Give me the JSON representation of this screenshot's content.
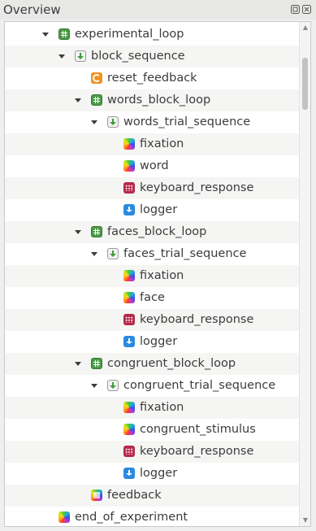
{
  "panel": {
    "title": "Overview",
    "float_label": "⧉",
    "close_label": "✕"
  },
  "scroll": {
    "up": "▲",
    "down": "▼"
  },
  "tree": [
    {
      "label": "experimental_loop",
      "type": "loop",
      "level": 0,
      "expanded": true
    },
    {
      "label": "block_sequence",
      "type": "sequence",
      "level": 1,
      "expanded": true
    },
    {
      "label": "reset_feedback",
      "type": "reset",
      "level": 2
    },
    {
      "label": "words_block_loop",
      "type": "loop",
      "level": 2,
      "expanded": true
    },
    {
      "label": "words_trial_sequence",
      "type": "sequence",
      "level": 3,
      "expanded": true
    },
    {
      "label": "fixation",
      "type": "sketchpad",
      "level": 4
    },
    {
      "label": "word",
      "type": "sketchpad",
      "level": 4
    },
    {
      "label": "keyboard_response",
      "type": "keyboard",
      "level": 4
    },
    {
      "label": "logger",
      "type": "logger",
      "level": 4
    },
    {
      "label": "faces_block_loop",
      "type": "loop",
      "level": 2,
      "expanded": true
    },
    {
      "label": "faces_trial_sequence",
      "type": "sequence",
      "level": 3,
      "expanded": true
    },
    {
      "label": "fixation",
      "type": "sketchpad",
      "level": 4
    },
    {
      "label": "face",
      "type": "sketchpad",
      "level": 4
    },
    {
      "label": "keyboard_response",
      "type": "keyboard",
      "level": 4
    },
    {
      "label": "logger",
      "type": "logger",
      "level": 4
    },
    {
      "label": "congruent_block_loop",
      "type": "loop",
      "level": 2,
      "expanded": true
    },
    {
      "label": "congruent_trial_sequence",
      "type": "sequence",
      "level": 3,
      "expanded": true
    },
    {
      "label": "fixation",
      "type": "sketchpad",
      "level": 4
    },
    {
      "label": "congruent_stimulus",
      "type": "sketchpad",
      "level": 4
    },
    {
      "label": "keyboard_response",
      "type": "keyboard",
      "level": 4
    },
    {
      "label": "logger",
      "type": "logger",
      "level": 4
    },
    {
      "label": "feedback",
      "type": "feedback",
      "level": 2
    },
    {
      "label": "end_of_experiment",
      "type": "sketchpad",
      "level": 0
    }
  ]
}
